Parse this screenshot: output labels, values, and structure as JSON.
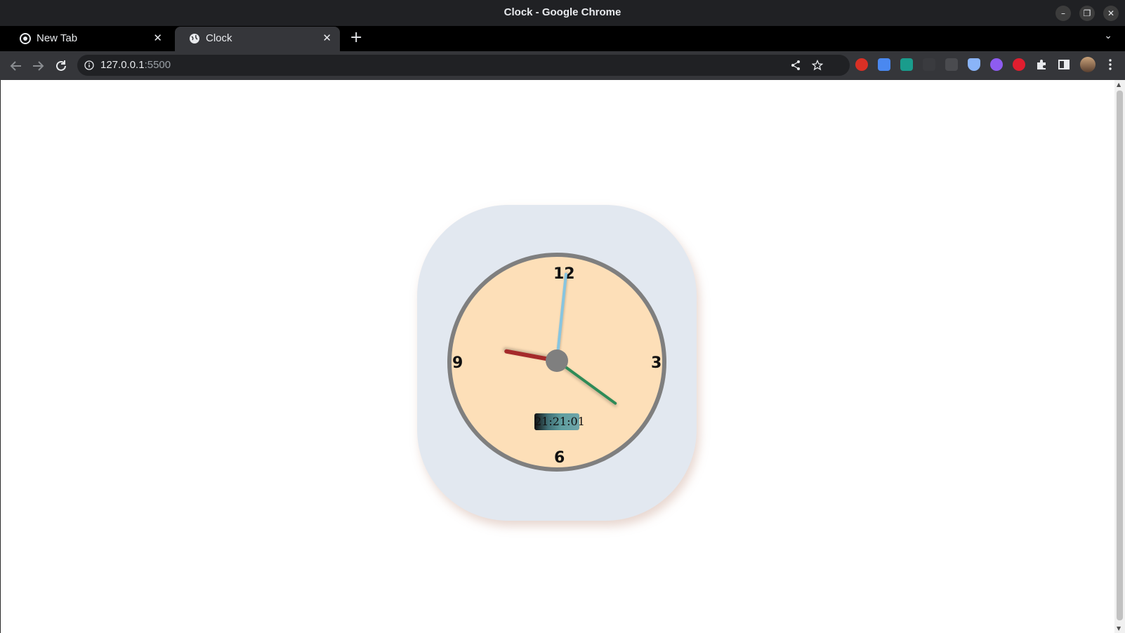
{
  "window": {
    "title": "Clock - Google Chrome"
  },
  "tabs": [
    {
      "label": "New Tab",
      "close": "✕"
    },
    {
      "label": "Clock",
      "close": "✕"
    }
  ],
  "toolbar": {
    "url_host": "127.0.0.1",
    "url_port": ":5500"
  },
  "clock": {
    "numerals": {
      "twelve": "12",
      "three": "3",
      "six": "6",
      "nine": "9"
    },
    "digital_time": "21:21:01",
    "time": {
      "hours": 21,
      "minutes": 21,
      "seconds": 1
    },
    "colors": {
      "hour_hand": "#a52a2a",
      "minute_hand": "#2e8b57",
      "second_hand": "#87c5e0",
      "face": "#fddfb8",
      "rim": "#7f7f7f",
      "card": "#e2e8f0"
    }
  },
  "extensions": [
    "adblock-icon",
    "docs-icon",
    "mail-icon",
    "json-icon",
    "css-icon",
    "shield-icon",
    "color-icon",
    "record-icon",
    "puzzle-icon",
    "side-panel-icon",
    "profile-avatar",
    "menu-icon"
  ]
}
